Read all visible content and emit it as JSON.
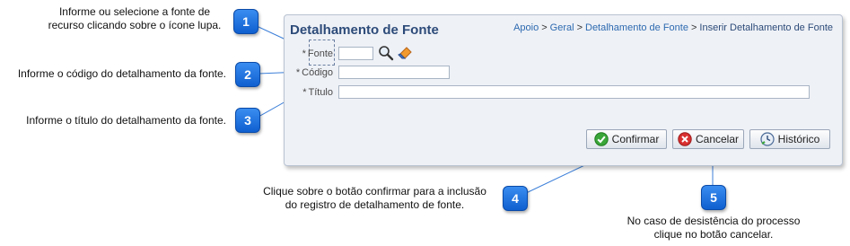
{
  "annotations": {
    "a1": "Informe ou selecione a fonte de\nrecurso clicando sobre o ícone lupa.",
    "a2": "Informe o código do detalhamento da fonte.",
    "a3": "Informe o título do detalhamento da fonte.",
    "a4": "Clique sobre o botão confirmar para a inclusão\ndo registro de detalhamento de fonte.",
    "a5": "No caso de desistência do processo\nclique no botão cancelar."
  },
  "badges": [
    "1",
    "2",
    "3",
    "4",
    "5"
  ],
  "panel": {
    "title": "Detalhamento de Fonte",
    "breadcrumb": [
      "Apoio",
      "Geral",
      "Detalhamento de Fonte"
    ],
    "breadcrumb_current": "Inserir Detalhamento de Fonte",
    "breadcrumb_sep": ">"
  },
  "form": {
    "required_mark": "*",
    "fonte_label": "Fonte",
    "fonte_value": "",
    "codigo_label": "Código",
    "codigo_value": "",
    "titulo_label": "Título",
    "titulo_value": ""
  },
  "icons": [
    "search-icon",
    "clear-icon"
  ],
  "buttons": {
    "confirmar": "Confirmar",
    "cancelar": "Cancelar",
    "historico": "Histórico"
  },
  "colors": {
    "badge": "#1a6fe0",
    "title": "#2d4b79",
    "link": "#2d6ab0",
    "line": "#3c7fd9"
  }
}
